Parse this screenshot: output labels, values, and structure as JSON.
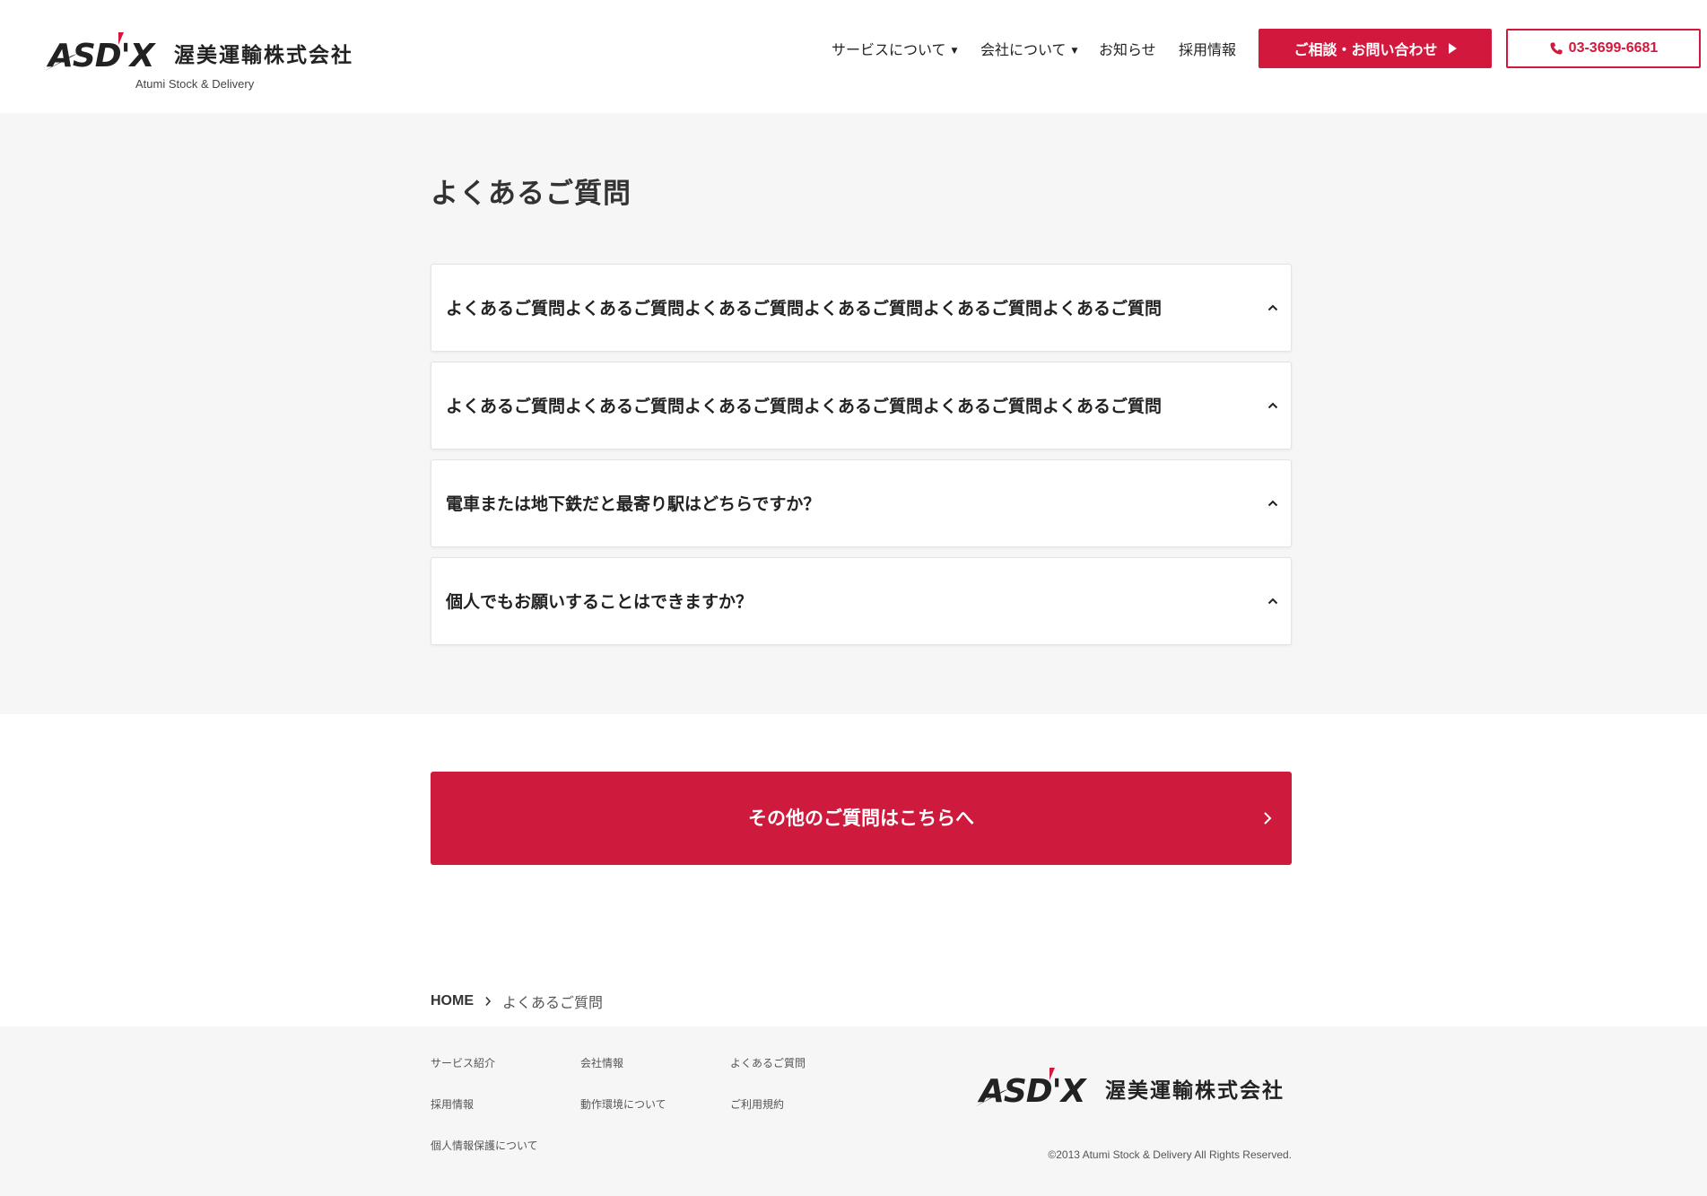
{
  "header": {
    "company_name": "渥美運輸株式会社",
    "company_sub": "Atumi Stock & Delivery",
    "logo_text": "ASD'X",
    "nav": {
      "services": "サービスについて",
      "company": "会社について",
      "news": "お知らせ",
      "recruit": "採用情報"
    },
    "contact_button": "ご相談・お問い合わせ",
    "tel_button": "03-3699-6681"
  },
  "faq": {
    "title": "よくあるご質問",
    "items": [
      {
        "question": "よくあるご質問よくあるご質問よくあるご質問よくあるご質問よくあるご質問よくあるご質問"
      },
      {
        "question": "よくあるご質問よくあるご質問よくあるご質問よくあるご質問よくあるご質問よくあるご質問"
      },
      {
        "question": "電車または地下鉄だと最寄り駅はどちらですか？"
      },
      {
        "question": "個人でもお願いすることはできますか？"
      }
    ]
  },
  "cta": {
    "label": "その他のご質問はこちらへ"
  },
  "breadcrumb": {
    "home": "HOME",
    "current": "よくあるご質問"
  },
  "footer": {
    "links": {
      "service_intro": "サービス紹介",
      "company_info": "会社情報",
      "faq": "よくあるご質問",
      "recruit": "採用情報",
      "environment": "動作環境について",
      "terms": "ご利用規約",
      "privacy": "個人情報保護について"
    },
    "company_name": "渥美運輸株式会社",
    "copyright": "©2013 Atumi Stock & Delivery All Rights Reserved."
  },
  "colors": {
    "accent": "#d2193d",
    "section_bg": "#f6f6f6"
  },
  "icons": [
    "caret-down-icon",
    "play-triangle-icon",
    "phone-icon",
    "chevron-up-icon",
    "chevron-right-icon"
  ]
}
